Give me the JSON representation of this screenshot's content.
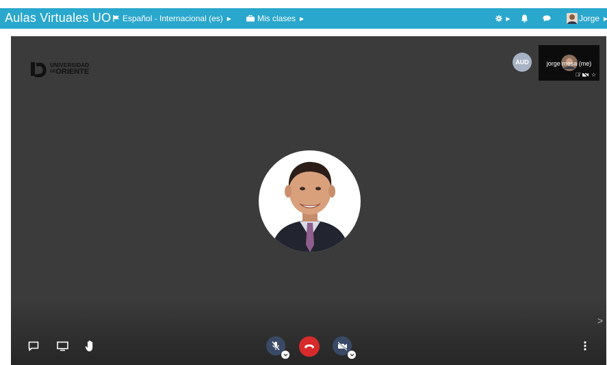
{
  "topbar": {
    "brand": "Aulas Virtuales UO",
    "language": "Español - Internacional (es)",
    "classes": "Mis clases",
    "user": "Jorge"
  },
  "meeting": {
    "logo_line1": "UNIVERSIDAD",
    "logo_line2": "ORIENTE",
    "logo_small": "DE",
    "aud_label": "AUD",
    "self_name": "jorge mesa (me)"
  },
  "icons": {
    "language": "flag-icon",
    "classes": "briefcase-icon",
    "settings": "gear-icon",
    "notifications": "bell-icon",
    "messages": "chat-bubble-icon",
    "chat": "chat-icon",
    "screen": "screen-share-icon",
    "hand": "raise-hand-icon",
    "mic": "microphone-muted-icon",
    "hangup": "hang-up-icon",
    "camera": "camera-off-icon",
    "more": "more-vertical-icon"
  },
  "colors": {
    "topbar": "#2aa7cc",
    "stage": "#3b3b3b",
    "hangup": "#d72a2a",
    "control_bg": "#3a4a66"
  }
}
